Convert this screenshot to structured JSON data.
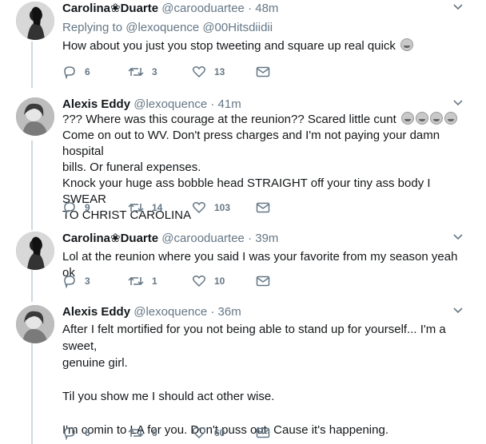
{
  "tweets": [
    {
      "name": "Carolina❀Duarte",
      "handle": "@carooduartee",
      "time": "48m",
      "reply_to": "Replying to @lexoquence @00Hitsdiidii",
      "lines": [
        "How about you just you stop tweeting and square up real quick"
      ],
      "emoji_count": 1,
      "replies": "6",
      "retweets": "3",
      "likes": "13"
    },
    {
      "name": "Alexis Eddy",
      "handle": "@lexoquence",
      "time": "41m",
      "lines": [
        "??? Where was this courage at the reunion?? Scared little cunt",
        "Come on out to WV. Don't press charges and I'm not paying your damn hospital",
        "bills. Or funeral expenses.",
        "Knock your huge ass bobble head STRAIGHT off your tiny ass body I SWEAR",
        "TO CHRIST CAROLINA"
      ],
      "emoji_count": 4,
      "replies": "9",
      "retweets": "14",
      "likes": "103"
    },
    {
      "name": "Carolina❀Duarte",
      "handle": "@carooduartee",
      "time": "39m",
      "lines": [
        "Lol at the reunion where you said I was your favorite from my season yeah ok"
      ],
      "replies": "3",
      "retweets": "1",
      "likes": "10"
    },
    {
      "name": "Alexis Eddy",
      "handle": "@lexoquence",
      "time": "36m",
      "lines": [
        "After I felt mortified for you not being able to stand up for yourself... I'm a sweet,",
        "genuine girl.",
        "",
        "Til you show me I should act other wise.",
        "",
        "I'm comin to LA for you. Don't puss out. Cause it's happening."
      ],
      "replies": "6",
      "retweets": "6",
      "likes": "60"
    }
  ],
  "separator": "·",
  "icons": {
    "reply": "reply-icon",
    "retweet": "retweet-icon",
    "like": "heart-icon",
    "dm": "envelope-icon",
    "caret": "chevron-down-icon"
  },
  "colors": {
    "text": "#14171a",
    "muted": "#657786",
    "thread_line": "#cfd9de"
  }
}
